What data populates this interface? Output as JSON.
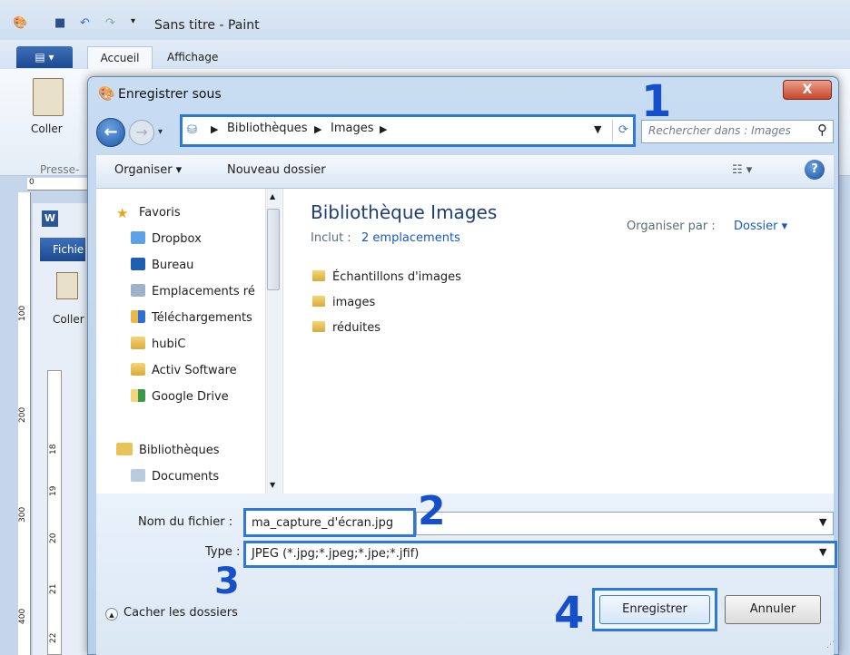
{
  "paint": {
    "window_title": "Sans titre - Paint",
    "tabs": [
      "Accueil",
      "Affichage"
    ],
    "paste_label": "Coller",
    "clipboard_group": "Presse-",
    "ruler_numbers": [
      "100",
      "200",
      "300",
      "400"
    ],
    "ruler_top_number": "0"
  },
  "word": {
    "tab_label": "Fichie",
    "paste_label": "Coller",
    "ruler_numbers": [
      "18",
      "19",
      "20",
      "21",
      "22"
    ]
  },
  "dialog": {
    "title": "Enregistrer sous",
    "close_label": "X",
    "address": {
      "crumbs": [
        "Bibliothèques",
        "Images"
      ]
    },
    "search_placeholder": "Rechercher dans : Images",
    "toolbar": {
      "organize": "Organiser ▾",
      "new_folder": "Nouveau dossier"
    },
    "nav": {
      "items": [
        {
          "label": "Favoris",
          "icon": "star-icon"
        },
        {
          "label": "Dropbox",
          "icon": "dropbox-icon"
        },
        {
          "label": "Bureau",
          "icon": "desktop-icon"
        },
        {
          "label": "Emplacements ré",
          "icon": "recent-places-icon"
        },
        {
          "label": "Téléchargements",
          "icon": "downloads-icon"
        },
        {
          "label": "hubiC",
          "icon": "folder-icon"
        },
        {
          "label": "Activ Software",
          "icon": "folder-icon"
        },
        {
          "label": "Google Drive",
          "icon": "google-drive-icon"
        },
        {
          "label": "Bibliothèques",
          "icon": "libraries-icon"
        },
        {
          "label": "Documents",
          "icon": "documents-icon"
        }
      ]
    },
    "library": {
      "title": "Bibliothèque Images",
      "includes_label": "Inclut :",
      "includes_link": "2 emplacements",
      "arrange_label": "Organiser par :",
      "arrange_value": "Dossier ▾"
    },
    "folders": [
      "Échantillons d'images",
      "images",
      "réduites"
    ],
    "form": {
      "filename_label": "Nom du fichier :",
      "filename_value": "ma_capture_d'écran.jpg",
      "type_label": "Type :",
      "type_value": "JPEG (*.jpg;*.jpeg;*.jpe;*.jfif)",
      "hide_folders": "Cacher les dossiers",
      "save_label": "Enregistrer",
      "cancel_label": "Annuler"
    }
  },
  "annotations": [
    "1",
    "2",
    "3",
    "4"
  ],
  "colors": {
    "highlight": "#2e78d6",
    "annotation": "#1550c8"
  }
}
